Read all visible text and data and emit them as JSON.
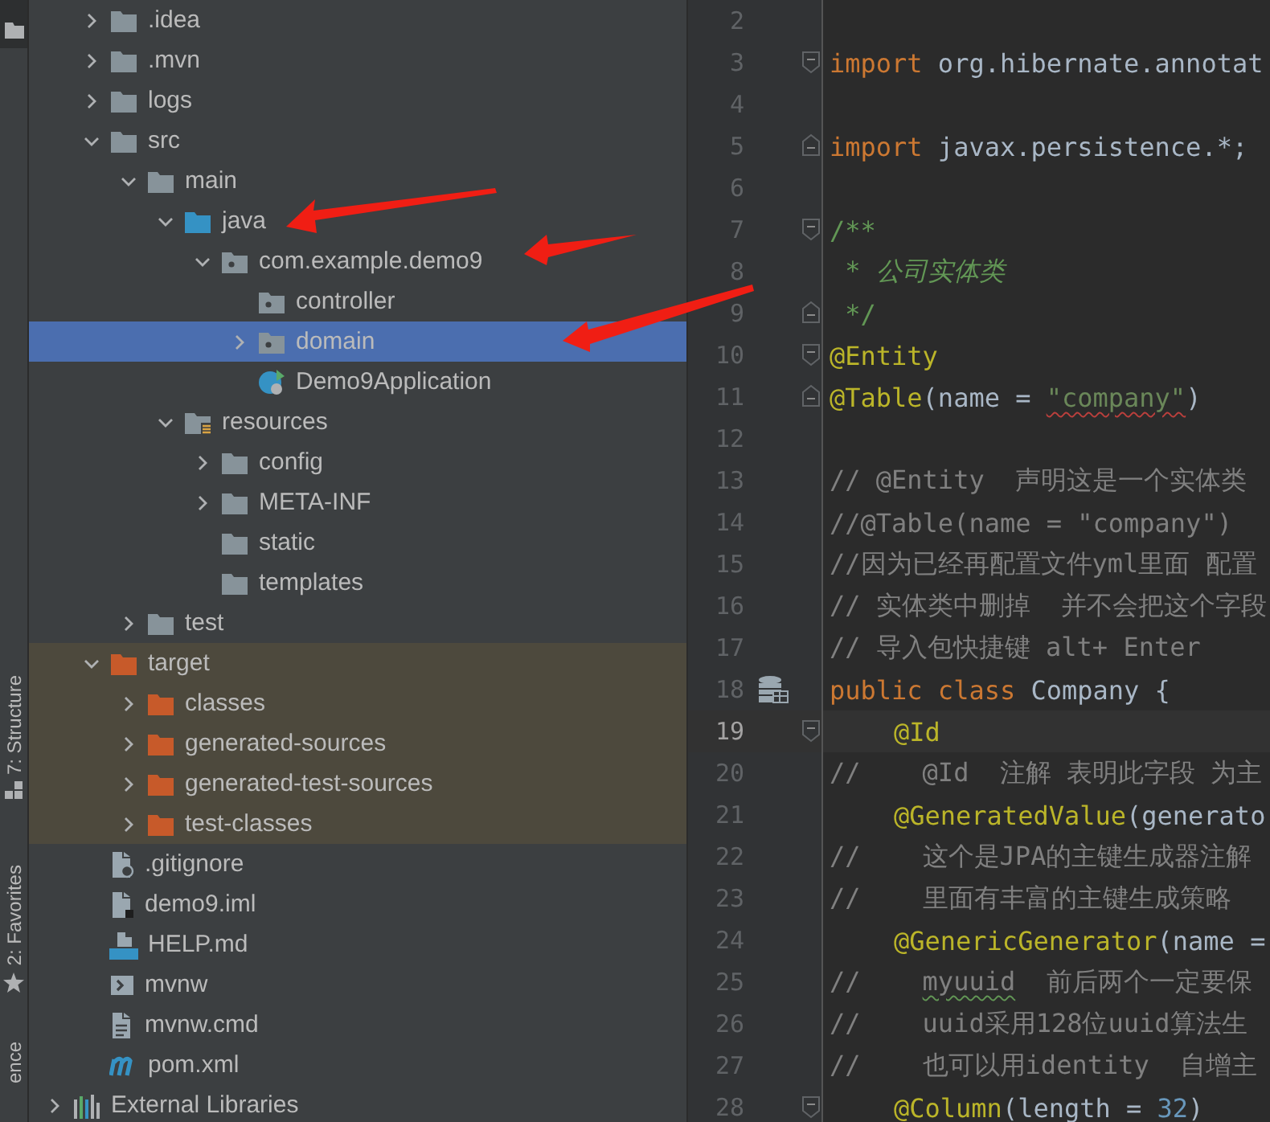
{
  "tool_strip": {
    "tabs": [
      {
        "label": "7: Structure",
        "kind": "structure"
      },
      {
        "label": "2: Favorites",
        "kind": "favorites"
      },
      {
        "label": "ence",
        "kind": "plain"
      }
    ]
  },
  "project_tree": {
    "items": [
      {
        "label": ".idea",
        "kind": "folder",
        "expanded": false,
        "selected": false
      },
      {
        "label": ".mvn",
        "kind": "folder",
        "expanded": false,
        "selected": false
      },
      {
        "label": "logs",
        "kind": "folder",
        "expanded": false,
        "selected": false
      },
      {
        "label": "src",
        "kind": "folder",
        "expanded": true,
        "selected": false,
        "children": [
          {
            "label": "main",
            "kind": "folder",
            "expanded": true,
            "selected": false,
            "children": [
              {
                "label": "java",
                "kind": "source-folder",
                "expanded": true,
                "selected": false,
                "children": [
                  {
                    "label": "com.example.demo9",
                    "kind": "package",
                    "expanded": true,
                    "selected": false,
                    "children": [
                      {
                        "label": "controller",
                        "kind": "package",
                        "selected": false
                      },
                      {
                        "label": "domain",
                        "kind": "package",
                        "expanded": false,
                        "selected": true
                      },
                      {
                        "label": "Demo9Application",
                        "kind": "spring-class",
                        "selected": false
                      }
                    ]
                  }
                ]
              },
              {
                "label": "resources",
                "kind": "resource-folder",
                "expanded": true,
                "selected": false,
                "children": [
                  {
                    "label": "config",
                    "kind": "folder",
                    "expanded": false,
                    "selected": false
                  },
                  {
                    "label": "META-INF",
                    "kind": "folder",
                    "expanded": false,
                    "selected": false
                  },
                  {
                    "label": "static",
                    "kind": "folder",
                    "selected": false
                  },
                  {
                    "label": "templates",
                    "kind": "folder",
                    "selected": false
                  }
                ]
              }
            ]
          },
          {
            "label": "test",
            "kind": "folder",
            "expanded": false,
            "selected": false
          }
        ]
      },
      {
        "label": "target",
        "kind": "excluded-folder",
        "expanded": true,
        "selected": false,
        "children": [
          {
            "label": "classes",
            "kind": "excluded-folder",
            "expanded": false,
            "selected": false
          },
          {
            "label": "generated-sources",
            "kind": "excluded-folder",
            "expanded": false,
            "selected": false
          },
          {
            "label": "generated-test-sources",
            "kind": "excluded-folder",
            "expanded": false,
            "selected": false
          },
          {
            "label": "test-classes",
            "kind": "excluded-folder",
            "expanded": false,
            "selected": false
          }
        ]
      },
      {
        "label": ".gitignore",
        "kind": "ignore-file",
        "selected": false
      },
      {
        "label": "demo9.iml",
        "kind": "module-file",
        "selected": false
      },
      {
        "label": "HELP.md",
        "kind": "markdown-file",
        "selected": false
      },
      {
        "label": "mvnw",
        "kind": "shell-file",
        "selected": false
      },
      {
        "label": "mvnw.cmd",
        "kind": "text-file",
        "selected": false
      },
      {
        "label": "pom.xml",
        "kind": "maven-file",
        "selected": false
      }
    ],
    "root_items": [
      {
        "label": "External Libraries",
        "kind": "libraries",
        "expanded": false,
        "selected": false
      }
    ]
  },
  "editor": {
    "lines": [
      {
        "number": "2",
        "current": false
      },
      {
        "number": "3",
        "current": false,
        "fold_start": true,
        "tokens": [
          {
            "kind": "keyword",
            "text": "import"
          },
          {
            "kind": "plain",
            "text": " org.hibernate.annotat"
          }
        ]
      },
      {
        "number": "4",
        "current": false
      },
      {
        "number": "5",
        "current": false,
        "fold_end": true,
        "tokens": [
          {
            "kind": "keyword",
            "text": "import"
          },
          {
            "kind": "plain",
            "text": " javax.persistence.*;"
          }
        ]
      },
      {
        "number": "6",
        "current": false
      },
      {
        "number": "7",
        "current": false,
        "fold_start": true,
        "tokens": [
          {
            "kind": "doc",
            "text": "/**"
          }
        ]
      },
      {
        "number": "8",
        "current": false,
        "tokens": [
          {
            "kind": "doc-italic",
            "text": " * 公司实体类"
          }
        ]
      },
      {
        "number": "9",
        "current": false,
        "fold_end": true,
        "tokens": [
          {
            "kind": "doc",
            "text": " */"
          }
        ]
      },
      {
        "number": "10",
        "current": false,
        "fold_start": true,
        "tokens": [
          {
            "kind": "annotation",
            "text": "@Entity"
          }
        ]
      },
      {
        "number": "11",
        "current": false,
        "fold_end": true,
        "tokens": [
          {
            "kind": "annotation",
            "text": "@Table"
          },
          {
            "kind": "plain",
            "text": "(name = "
          },
          {
            "kind": "string",
            "text": "\"company\"",
            "error": true
          },
          {
            "kind": "plain",
            "text": ")"
          }
        ]
      },
      {
        "number": "12",
        "current": false
      },
      {
        "number": "13",
        "current": false,
        "tokens": [
          {
            "kind": "comment",
            "text": "// @Entity  声明这是一个实体类"
          }
        ]
      },
      {
        "number": "14",
        "current": false,
        "tokens": [
          {
            "kind": "comment",
            "text": "//@Table(name = \"company\")"
          }
        ]
      },
      {
        "number": "15",
        "current": false,
        "tokens": [
          {
            "kind": "comment",
            "text": "//因为已经再配置文件yml里面 配置"
          }
        ]
      },
      {
        "number": "16",
        "current": false,
        "tokens": [
          {
            "kind": "comment",
            "text": "// 实体类中删掉  并不会把这个字段"
          }
        ]
      },
      {
        "number": "17",
        "current": false,
        "tokens": [
          {
            "kind": "comment",
            "text": "// 导入包快捷键 alt+ Enter"
          }
        ]
      },
      {
        "number": "18",
        "current": false,
        "entity": true,
        "tokens": [
          {
            "kind": "keyword",
            "text": "public class "
          },
          {
            "kind": "plain",
            "text": "Company {"
          }
        ]
      },
      {
        "number": "19",
        "current": true,
        "fold_start": true,
        "indented": true,
        "tokens": [
          {
            "kind": "annotation",
            "text": "@Id"
          }
        ]
      },
      {
        "number": "20",
        "current": false,
        "tokens": [
          {
            "kind": "comment",
            "text": "//    @Id  注解 表明此字段 为主"
          }
        ]
      },
      {
        "number": "21",
        "current": false,
        "indented": true,
        "tokens": [
          {
            "kind": "annotation",
            "text": "@GeneratedValue"
          },
          {
            "kind": "plain",
            "text": "(generato"
          }
        ]
      },
      {
        "number": "22",
        "current": false,
        "tokens": [
          {
            "kind": "comment",
            "text": "//    这个是JPA的主键生成器注解"
          }
        ]
      },
      {
        "number": "23",
        "current": false,
        "tokens": [
          {
            "kind": "comment",
            "text": "//    里面有丰富的主键生成策略"
          }
        ]
      },
      {
        "number": "24",
        "current": false,
        "indented": true,
        "tokens": [
          {
            "kind": "annotation",
            "text": "@GenericGenerator"
          },
          {
            "kind": "plain",
            "text": "(name ="
          }
        ]
      },
      {
        "number": "25",
        "current": false,
        "tokens": [
          {
            "kind": "comment",
            "text": "//    "
          },
          {
            "kind": "comment",
            "text": "myuuid",
            "typo": true
          },
          {
            "kind": "comment",
            "text": "  前后两个一定要保"
          }
        ]
      },
      {
        "number": "26",
        "current": false,
        "tokens": [
          {
            "kind": "comment",
            "text": "//    uuid采用128位uuid算法生"
          }
        ]
      },
      {
        "number": "27",
        "current": false,
        "tokens": [
          {
            "kind": "comment",
            "text": "//    也可以用identity  自增主"
          }
        ]
      },
      {
        "number": "28",
        "current": false,
        "fold_start": true,
        "indented": true,
        "tokens": [
          {
            "kind": "annotation",
            "text": "@Column"
          },
          {
            "kind": "plain",
            "text": "(length = "
          },
          {
            "kind": "number",
            "text": "32"
          },
          {
            "kind": "plain",
            "text": ")"
          }
        ]
      }
    ]
  }
}
